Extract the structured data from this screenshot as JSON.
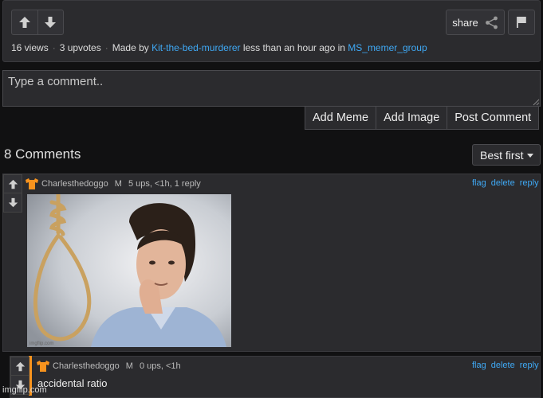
{
  "post": {
    "views": "16 views",
    "upvotes": "3 upvotes",
    "made_by_prefix": "Made by",
    "author": "Kit-the-bed-murderer",
    "time_text": "less than an hour ago in",
    "stream": "MS_memer_group",
    "share_label": "share"
  },
  "composer": {
    "placeholder": "Type a comment..",
    "add_meme": "Add Meme",
    "add_image": "Add Image",
    "post_comment": "Post Comment"
  },
  "comments_header": {
    "count_label": "8 Comments",
    "sort_label": "Best first"
  },
  "comments": [
    {
      "username": "Charlesthedoggo",
      "badge": "M",
      "stats": "5 ups, <1h, 1 reply",
      "links": [
        "flag",
        "delete",
        "reply"
      ],
      "image_watermark": "imgflip.com"
    },
    {
      "username": "Charlesthedoggo",
      "badge": "M",
      "stats": "0 ups, <1h",
      "links": [
        "flag",
        "delete",
        "reply"
      ],
      "text": "accidental ratio"
    }
  ],
  "watermark": "imgflip.com",
  "colors": {
    "accent_link": "#3fa9f5",
    "accent_orange": "#f7931e",
    "panel": "#2b2b2e",
    "background": "#111112"
  }
}
